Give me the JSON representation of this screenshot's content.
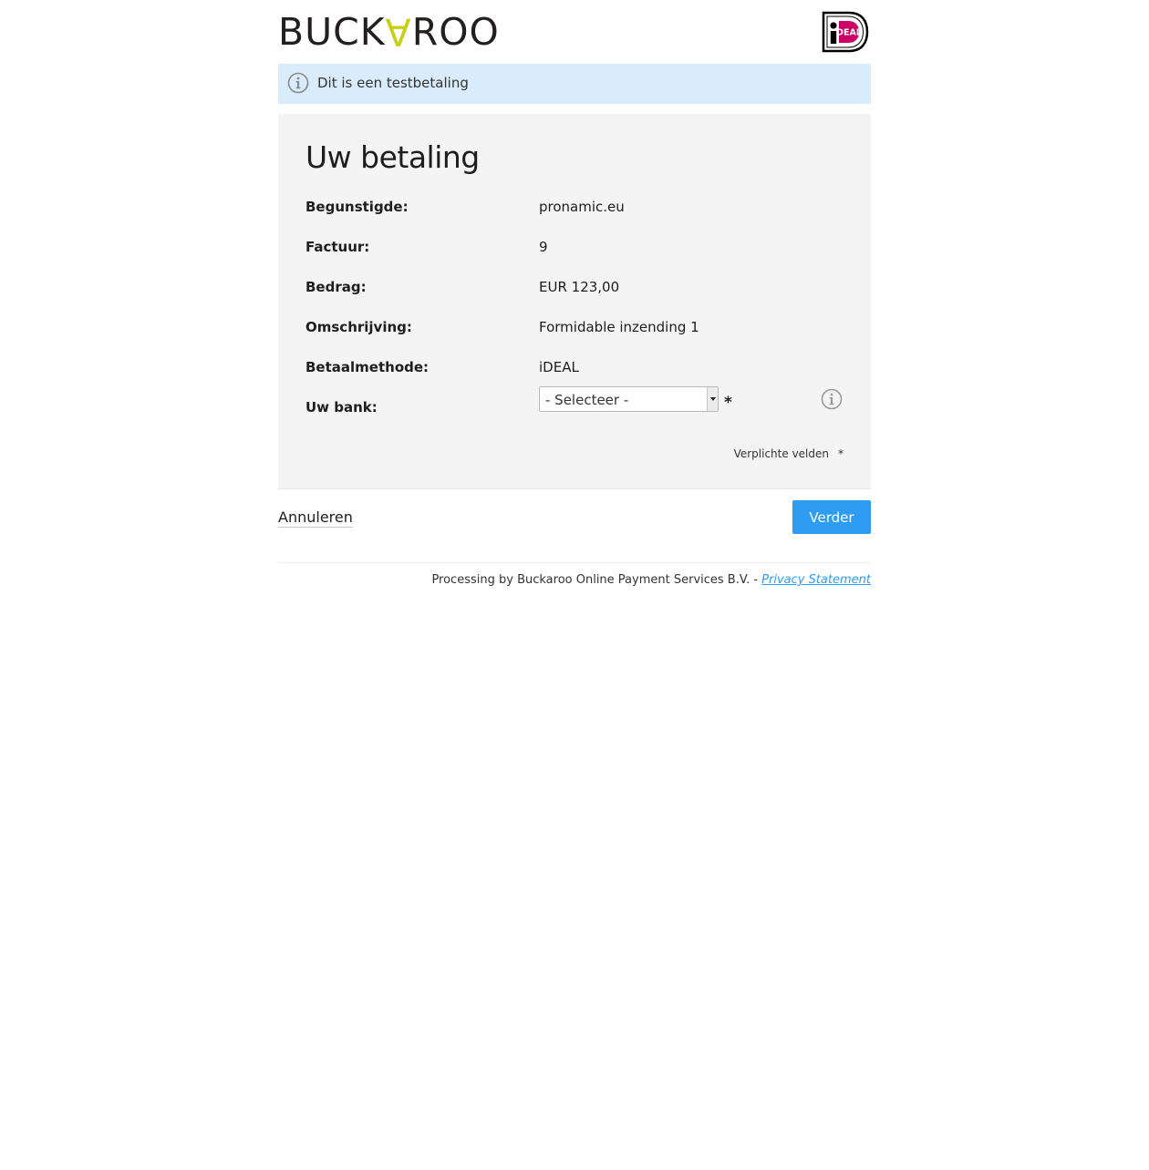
{
  "header": {
    "logo_prefix": "BUCK",
    "logo_a": "A",
    "logo_suffix": "ROO",
    "ideal_logo_text": "iDEAL"
  },
  "notice": {
    "text": "Dit is een testbetaling",
    "background_color": "#d9ecfb"
  },
  "panel": {
    "title": "Uw betaling",
    "rows": [
      {
        "label": "Begunstigde:",
        "value": "pronamic.eu"
      },
      {
        "label": "Factuur:",
        "value": "9"
      },
      {
        "label": "Bedrag:",
        "value": "EUR 123,00"
      },
      {
        "label": "Omschrijving:",
        "value": "Formidable inzending 1"
      },
      {
        "label": "Betaalmethode:",
        "value": "iDEAL"
      }
    ],
    "bank": {
      "label": "Uw bank:",
      "select_value": "- Selecteer -",
      "required_marker": "*"
    },
    "required_note": {
      "text": "Verplichte velden",
      "marker": "*"
    }
  },
  "actions": {
    "cancel_label": "Annuleren",
    "next_label": "Verder",
    "next_color": "#2f9cf4"
  },
  "footer": {
    "text": "Processing by Buckaroo Online Payment Services B.V. - ",
    "link_label": "Privacy Statement"
  },
  "brand": {
    "logo_accent_color": "#c9cf12",
    "ideal_pink": "#cc0066"
  }
}
